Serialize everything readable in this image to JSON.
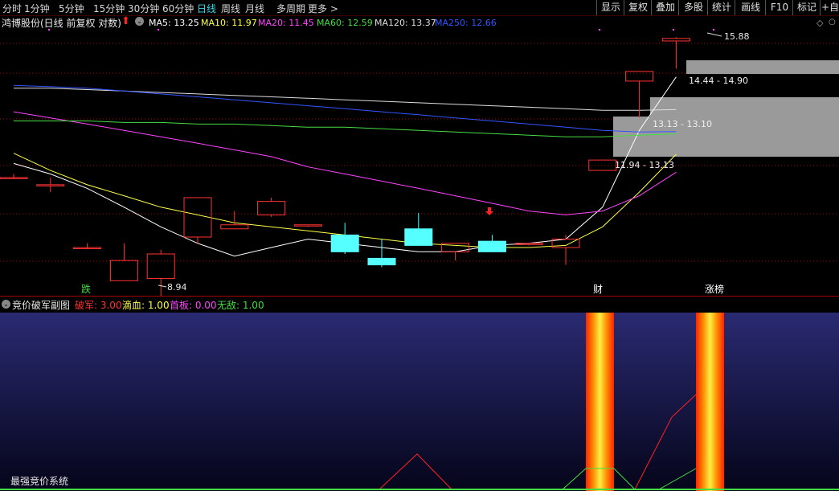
{
  "toolbar": {
    "periods": [
      "分时",
      "1分钟",
      "5分钟",
      "15分钟",
      "30分钟",
      "60分钟",
      "日线",
      "周线",
      "月线",
      "多周期",
      "更多 >"
    ],
    "active_index": 6,
    "right_buttons": [
      "显示",
      "复权",
      "叠加",
      "多股",
      "统计",
      "画线",
      "F10",
      "标记",
      "+自"
    ]
  },
  "header": {
    "stock_title": "鸿博股份(日线 前复权 对数)",
    "ma": [
      {
        "label": "MA5: 13.25",
        "color": "#ffffff"
      },
      {
        "label": "MA10: 11.97",
        "color": "#ffff44"
      },
      {
        "label": "MA20: 11.45",
        "color": "#ff44ff"
      },
      {
        "label": "MA60: 12.59",
        "color": "#44dd44"
      },
      {
        "label": "MA120: 13.37",
        "color": "#dddddd"
      },
      {
        "label": "MA250: 12.66",
        "color": "#3355ff"
      }
    ]
  },
  "price_panel": {
    "annotations": {
      "high": "15.88",
      "low": "8.94",
      "zone1": "14.44 - 14.90",
      "zone2": "13.13 - 13.10",
      "zone3": "11.94 - 13.13"
    },
    "labels": {
      "die": "跌",
      "cai": "财",
      "zhangbang": "涨榜"
    },
    "colors": {
      "up": "#ff3333",
      "down": "#55ffff",
      "grid": "#aa0000"
    }
  },
  "chart_data": {
    "type": "candlestick",
    "candles": [
      {
        "o": 11.3,
        "c": 11.3,
        "h": 11.4,
        "l": 11.3
      },
      {
        "o": 11.1,
        "c": 11.1,
        "h": 11.3,
        "l": 10.9
      },
      {
        "o": 9.5,
        "c": 9.5,
        "h": 9.6,
        "l": 9.5
      },
      {
        "o": 8.75,
        "c": 9.2,
        "h": 9.6,
        "l": 8.75
      },
      {
        "o": 8.8,
        "c": 9.35,
        "h": 9.45,
        "l": 8.3
      },
      {
        "o": 9.75,
        "c": 10.75,
        "h": 10.75,
        "l": 9.6
      },
      {
        "o": 9.95,
        "c": 10.05,
        "h": 10.4,
        "l": 9.95
      },
      {
        "o": 10.3,
        "c": 10.65,
        "h": 10.75,
        "l": 10.25
      },
      {
        "o": 10.05,
        "c": 10.05,
        "h": 10.05,
        "l": 10.0
      },
      {
        "o": 9.8,
        "c": 9.4,
        "h": 10.1,
        "l": 9.35
      },
      {
        "o": 9.25,
        "c": 9.1,
        "h": 9.7,
        "l": 9.05
      },
      {
        "o": 9.95,
        "c": 9.55,
        "h": 10.35,
        "l": 9.55
      },
      {
        "o": 9.4,
        "c": 9.6,
        "h": 9.6,
        "l": 9.2
      },
      {
        "o": 9.65,
        "c": 9.4,
        "h": 9.8,
        "l": 9.4
      },
      {
        "o": 9.6,
        "c": 9.6,
        "h": 9.6,
        "l": 9.55
      },
      {
        "o": 9.5,
        "c": 9.7,
        "h": 9.8,
        "l": 9.1
      },
      {
        "o": 11.5,
        "c": 11.8,
        "h": 11.8,
        "l": 11.5
      },
      {
        "o": 14.35,
        "c": 14.7,
        "h": 14.7,
        "l": 13.1
      },
      {
        "o": 15.85,
        "c": 15.95,
        "h": 16.0,
        "l": 14.8
      }
    ],
    "price_range": [
      8.6,
      16.2
    ],
    "ma_lines": [
      {
        "name": "MA5",
        "color": "#ffffff",
        "values": [
          11.7,
          11.4,
          11.0,
          10.5,
          10.0,
          9.6,
          9.3,
          9.5,
          9.7,
          9.6,
          9.5,
          9.4,
          9.4,
          9.55,
          9.6,
          9.7,
          10.5,
          12.7,
          14.5
        ]
      },
      {
        "name": "MA10",
        "color": "#ffff44",
        "values": [
          12.0,
          11.5,
          11.1,
          10.8,
          10.5,
          10.3,
          10.1,
          10.0,
          9.9,
          9.8,
          9.7,
          9.6,
          9.55,
          9.5,
          9.5,
          9.55,
          10.0,
          10.9,
          11.97
        ]
      },
      {
        "name": "MA20",
        "color": "#ff44ff",
        "values": [
          13.3,
          13.1,
          12.9,
          12.7,
          12.5,
          12.3,
          12.1,
          11.9,
          11.6,
          11.4,
          11.2,
          11.0,
          10.8,
          10.6,
          10.4,
          10.3,
          10.4,
          10.8,
          11.45
        ]
      },
      {
        "name": "MA60",
        "color": "#44dd44",
        "values": [
          13.0,
          13.0,
          13.0,
          12.95,
          12.95,
          12.9,
          12.9,
          12.85,
          12.8,
          12.8,
          12.75,
          12.7,
          12.65,
          12.6,
          12.55,
          12.5,
          12.5,
          12.55,
          12.59
        ]
      },
      {
        "name": "MA120",
        "color": "#dddddd",
        "values": [
          14.1,
          14.1,
          14.05,
          14.0,
          13.95,
          13.9,
          13.85,
          13.8,
          13.75,
          13.7,
          13.65,
          13.6,
          13.55,
          13.5,
          13.45,
          13.4,
          13.35,
          13.35,
          13.37
        ]
      },
      {
        "name": "MA250",
        "color": "#3355ff",
        "values": [
          14.2,
          14.15,
          14.1,
          14.0,
          13.9,
          13.8,
          13.7,
          13.6,
          13.5,
          13.4,
          13.3,
          13.2,
          13.1,
          13.0,
          12.9,
          12.8,
          12.7,
          12.65,
          12.66
        ]
      }
    ]
  },
  "sub_panel": {
    "title": "竞价破军副图",
    "indicators": [
      {
        "label": "破军: 3.00",
        "color": "#ff3333"
      },
      {
        "label": "滴血: 1.00",
        "color": "#ffff44"
      },
      {
        "label": "首板: 0.00",
        "color": "#ff44ff"
      },
      {
        "label": "无敌: 1.00",
        "color": "#44dd44"
      }
    ],
    "footer": "最强竞价系统"
  }
}
